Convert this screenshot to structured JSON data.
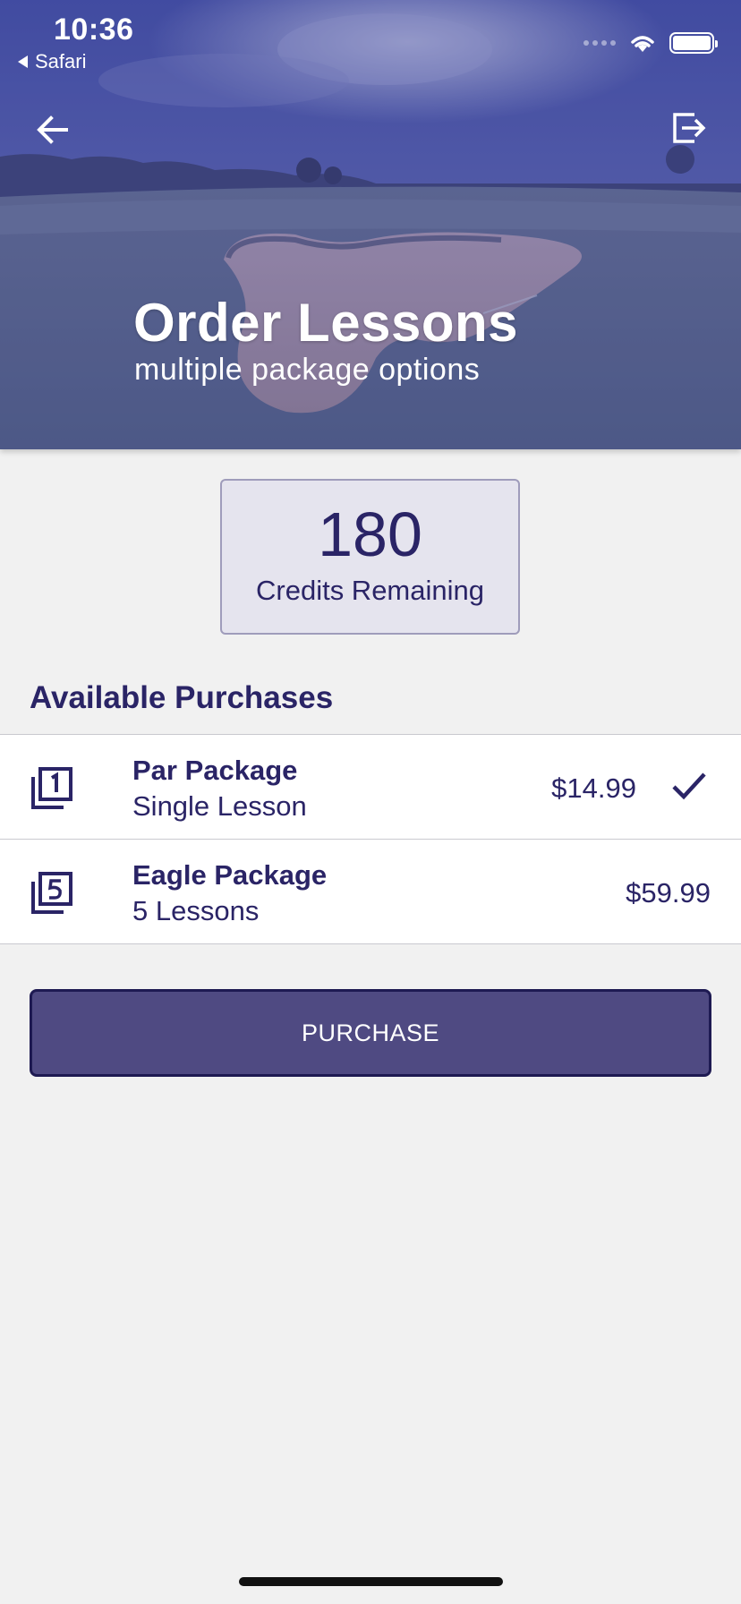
{
  "status_bar": {
    "time": "10:36",
    "back_app": "Safari"
  },
  "header": {
    "back_icon": "arrow-left-icon",
    "logout_icon": "logout-icon",
    "title": "Order Lessons",
    "subtitle": "multiple package options"
  },
  "credits": {
    "value": "180",
    "label": "Credits Remaining"
  },
  "purchases": {
    "title": "Available Purchases",
    "items": [
      {
        "name": "Par Package",
        "description": "Single Lesson",
        "price": "$14.99",
        "icon": "filter-1-icon",
        "selected": true
      },
      {
        "name": "Eagle Package",
        "description": "5 Lessons",
        "price": "$59.99",
        "icon": "filter-5-icon",
        "selected": false
      }
    ]
  },
  "actions": {
    "purchase_label": "PURCHASE"
  },
  "colors": {
    "accent": "#2a2466",
    "button": "#4f4a82",
    "background": "#f1f1f1",
    "credits_bg": "#e5e4ee"
  }
}
